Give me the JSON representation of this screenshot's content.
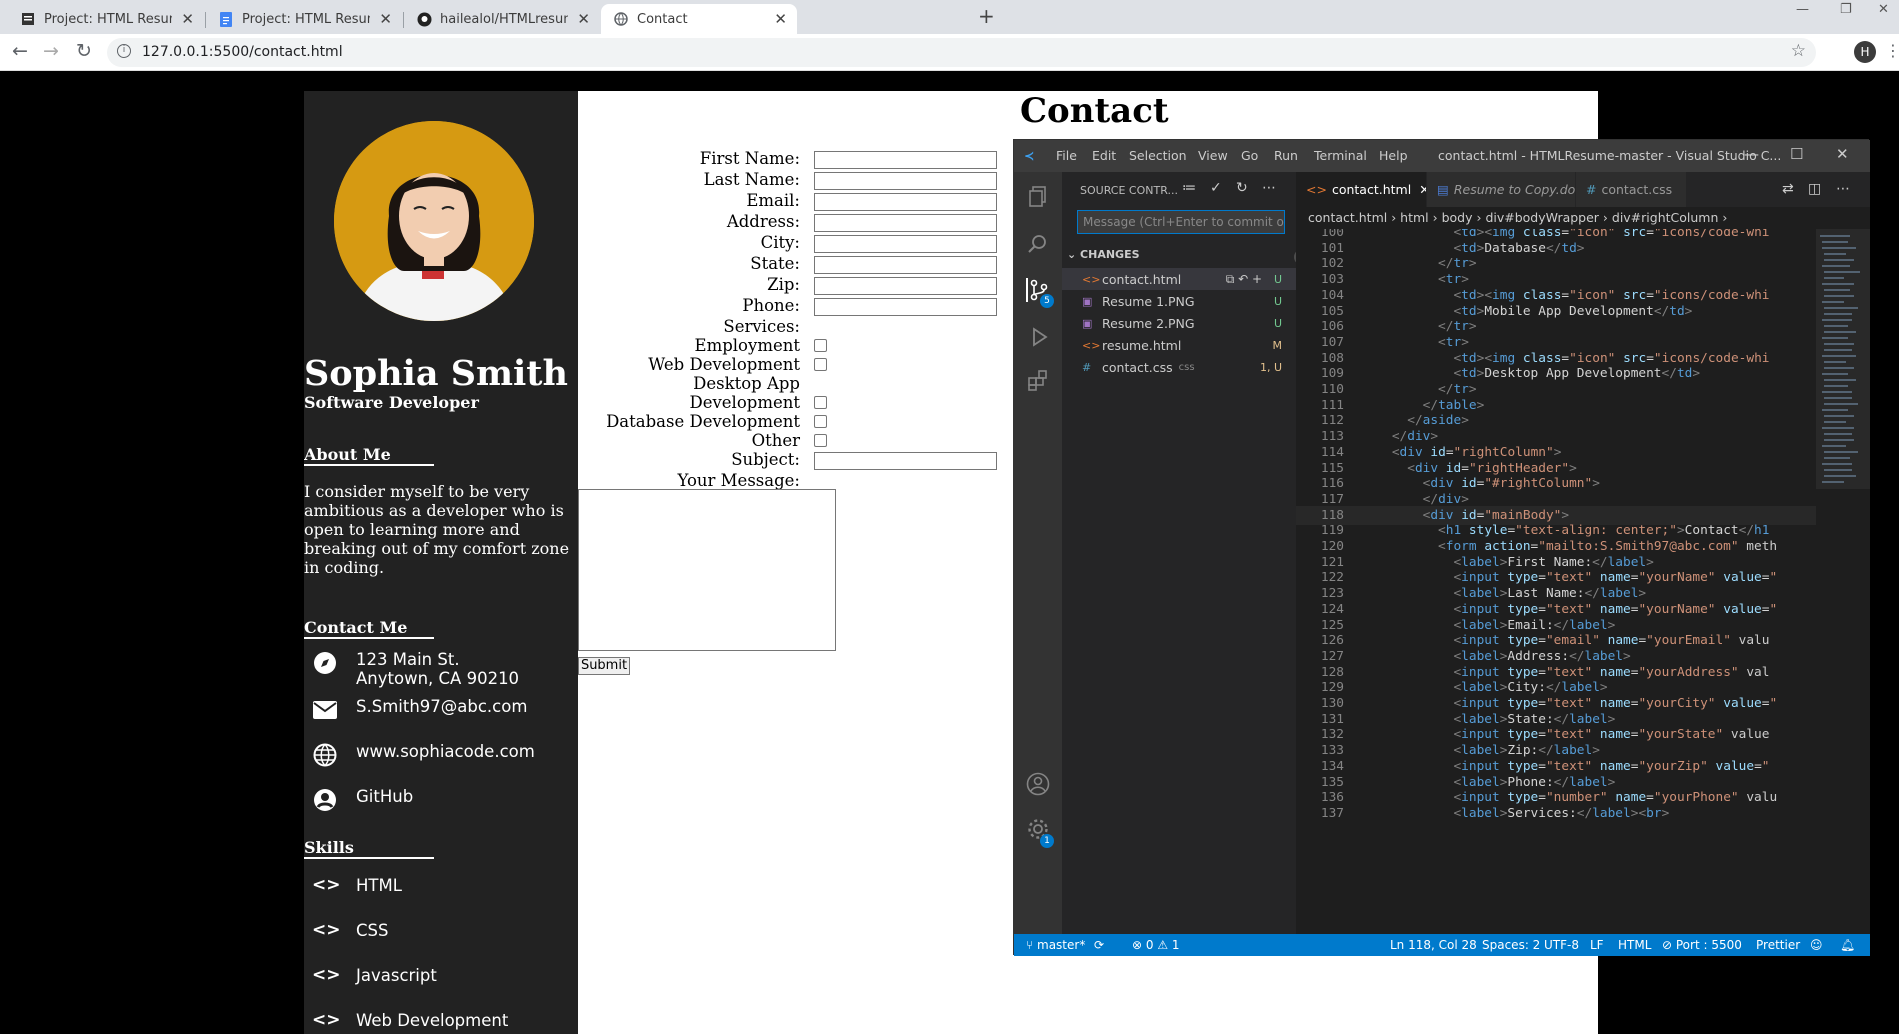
{
  "browser": {
    "tabs": [
      {
        "title": "Project: HTML Resume - Contact",
        "active": false
      },
      {
        "title": "Project: HTML Resume - Google",
        "active": false
      },
      {
        "title": "hailealol/HTMLresume",
        "active": false
      },
      {
        "title": "Contact",
        "active": true
      }
    ],
    "url": "127.0.0.1:5500/contact.html",
    "avatar": "H"
  },
  "resume": {
    "name": "Sophia Smith",
    "title": "Software Developer",
    "about_heading": "About Me",
    "about": "I consider myself to be very ambitious as a developer who is open to learning more and breaking out of my comfort zone in coding.",
    "contact_heading": "Contact Me",
    "address1": "123 Main St.",
    "address2": "Anytown, CA 90210",
    "email": "S.Smith97@abc.com",
    "website": "www.sophiacode.com",
    "github": "GitHub",
    "skills_heading": "Skills",
    "skills": [
      "HTML",
      "CSS",
      "Javascript",
      "Web Development"
    ]
  },
  "form": {
    "heading": "Contact",
    "first_name": "First Name:",
    "last_name": "Last Name:",
    "email": "Email:",
    "address": "Address:",
    "city": "City:",
    "state": "State:",
    "zip": "Zip:",
    "phone": "Phone:",
    "services": "Services:",
    "employment": "Employment",
    "webdev": "Web Development",
    "desktop1": "Desktop App",
    "desktop2": "Development",
    "database": "Database Development",
    "other": "Other",
    "subject": "Subject:",
    "message": "Your Message:",
    "submit": "Submit"
  },
  "vscode": {
    "menu": [
      "File",
      "Edit",
      "Selection",
      "View",
      "Go",
      "Run",
      "Terminal",
      "Help"
    ],
    "window_title": "contact.html - HTMLResume-master - Visual Studio C...",
    "sidebar_title": "SOURCE CONTR...",
    "commit_placeholder": "Message (Ctrl+Enter to commit on '...",
    "changes_label": "CHANGES",
    "changes_count": "5",
    "scm_badge": "5",
    "settings_badge": "1",
    "files": [
      {
        "name": "contact.html",
        "status": "U",
        "ext": ""
      },
      {
        "name": "Resume 1.PNG",
        "status": "U",
        "ext": ""
      },
      {
        "name": "Resume 2.PNG",
        "status": "U",
        "ext": ""
      },
      {
        "name": "resume.html",
        "status": "M",
        "ext": ""
      },
      {
        "name": "contact.css",
        "status": "1, U",
        "ext": "css"
      }
    ],
    "tabs": [
      "contact.html",
      "Resume to Copy.docx",
      "contact.css"
    ],
    "breadcrumb": "contact.html › html › body › div#bodyWrapper › div#rightColumn ›",
    "status": {
      "branch": "master*",
      "problems": "0",
      "warnings": "1",
      "position": "Ln 118, Col 28",
      "spaces": "Spaces: 2",
      "encoding": "UTF-8",
      "eol": "LF",
      "lang": "HTML",
      "port": "Port : 5500",
      "formatter": "Prettier"
    }
  },
  "accent": "#007acc"
}
